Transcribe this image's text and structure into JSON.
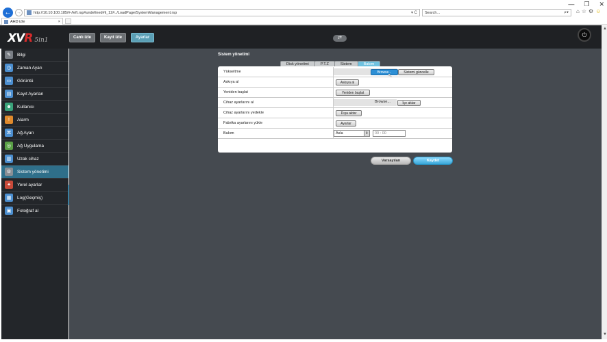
{
  "browser": {
    "url": "http://10.10.100.185/#-/left.rsp#undefined#li_12#../LoadPage/SystemManagement.rsp",
    "url_controls": "▾ C",
    "search_placeholder": "Search...",
    "tab_title": "AHD izle",
    "tab_close": "×",
    "win_min": "—",
    "win_restore": "❐",
    "win_close": "✕",
    "tool_icons": [
      "⌂",
      "☆",
      "⚙",
      "☺"
    ],
    "search_icon": "⌕▾"
  },
  "header": {
    "logo_main_x": "X",
    "logo_main_v": "V",
    "logo_main_r": "R",
    "logo_sub": "5in1",
    "buttons": [
      {
        "label": "Canlı izle",
        "active": false
      },
      {
        "label": "Kayıt izle",
        "active": false
      },
      {
        "label": "Ayarlar",
        "active": true
      }
    ],
    "swap_icon": "⇄",
    "power_icon": "⏻"
  },
  "sidebar": {
    "items": [
      {
        "label": "Bilgi",
        "icon": "info-icon",
        "color": "#7a7f86",
        "glyph": "✎"
      },
      {
        "label": "Zaman Ayarı",
        "icon": "clock-icon",
        "color": "#4c8fd0",
        "glyph": "◷"
      },
      {
        "label": "Görüntü",
        "icon": "display-icon",
        "color": "#4c8fd0",
        "glyph": "▭"
      },
      {
        "label": "Kayıt Ayarları",
        "icon": "record-icon",
        "color": "#4c8fd0",
        "glyph": "▤"
      },
      {
        "label": "Kullanıcı",
        "icon": "user-icon",
        "color": "#3aa37a",
        "glyph": "☻"
      },
      {
        "label": "Alarm",
        "icon": "alarm-icon",
        "color": "#e08a2c",
        "glyph": "!"
      },
      {
        "label": "Ağ Ayarı",
        "icon": "network-icon",
        "color": "#4c8fd0",
        "glyph": "⌘"
      },
      {
        "label": "Ağ Uygulama",
        "icon": "network-app-icon",
        "color": "#5aa046",
        "glyph": "◎"
      },
      {
        "label": "Uzak cihaz",
        "icon": "remote-device-icon",
        "color": "#4c8fd0",
        "glyph": "▥"
      },
      {
        "label": "Sistem yönetimi",
        "icon": "system-icon",
        "color": "#8a8f95",
        "glyph": "⚙",
        "active": true
      },
      {
        "label": "Yerel ayarlar",
        "icon": "local-settings-icon",
        "color": "#c94a3a",
        "glyph": "✦"
      },
      {
        "label": "Log(Geçmiş)",
        "icon": "log-icon",
        "color": "#4c8fd0",
        "glyph": "▦"
      },
      {
        "label": "Fotoğraf al",
        "icon": "camera-icon",
        "color": "#4c8fd0",
        "glyph": "▣"
      }
    ]
  },
  "main": {
    "section_title": "Sistem yönetimi",
    "tabs": [
      {
        "label": "Disk yönetimi",
        "active": false
      },
      {
        "label": "P.T.Z",
        "active": false
      },
      {
        "label": "Sistem",
        "active": false
      },
      {
        "label": "Bakım",
        "active": true
      }
    ],
    "rows": {
      "upgrade": {
        "label": "Yükseltme",
        "browse": "Browse...",
        "action": "Sistemi güncelle"
      },
      "suspend": {
        "label": "Askıya al",
        "action": "Askıya al"
      },
      "restart": {
        "label": "Yeniden başlat",
        "action": "Yeniden başlat"
      },
      "import": {
        "label": "Cihaz ayarlarını al",
        "browse": "Browse...",
        "action": "İçe aktar"
      },
      "backup": {
        "label": "Cihaz ayarlarını yedekle",
        "action": "Dışa aktar"
      },
      "factory": {
        "label": "Fabrika ayarlarını yükle",
        "action": "Ayarlar"
      },
      "maintenance": {
        "label": "Bakım",
        "select_value": "Asla",
        "select_arrow": "⇕",
        "time_value": "00 : 00"
      }
    },
    "footer": {
      "default_label": "Varsayılan",
      "save_label": "Kaydet"
    }
  },
  "scroll": {
    "up": "▲",
    "down": "▼"
  }
}
